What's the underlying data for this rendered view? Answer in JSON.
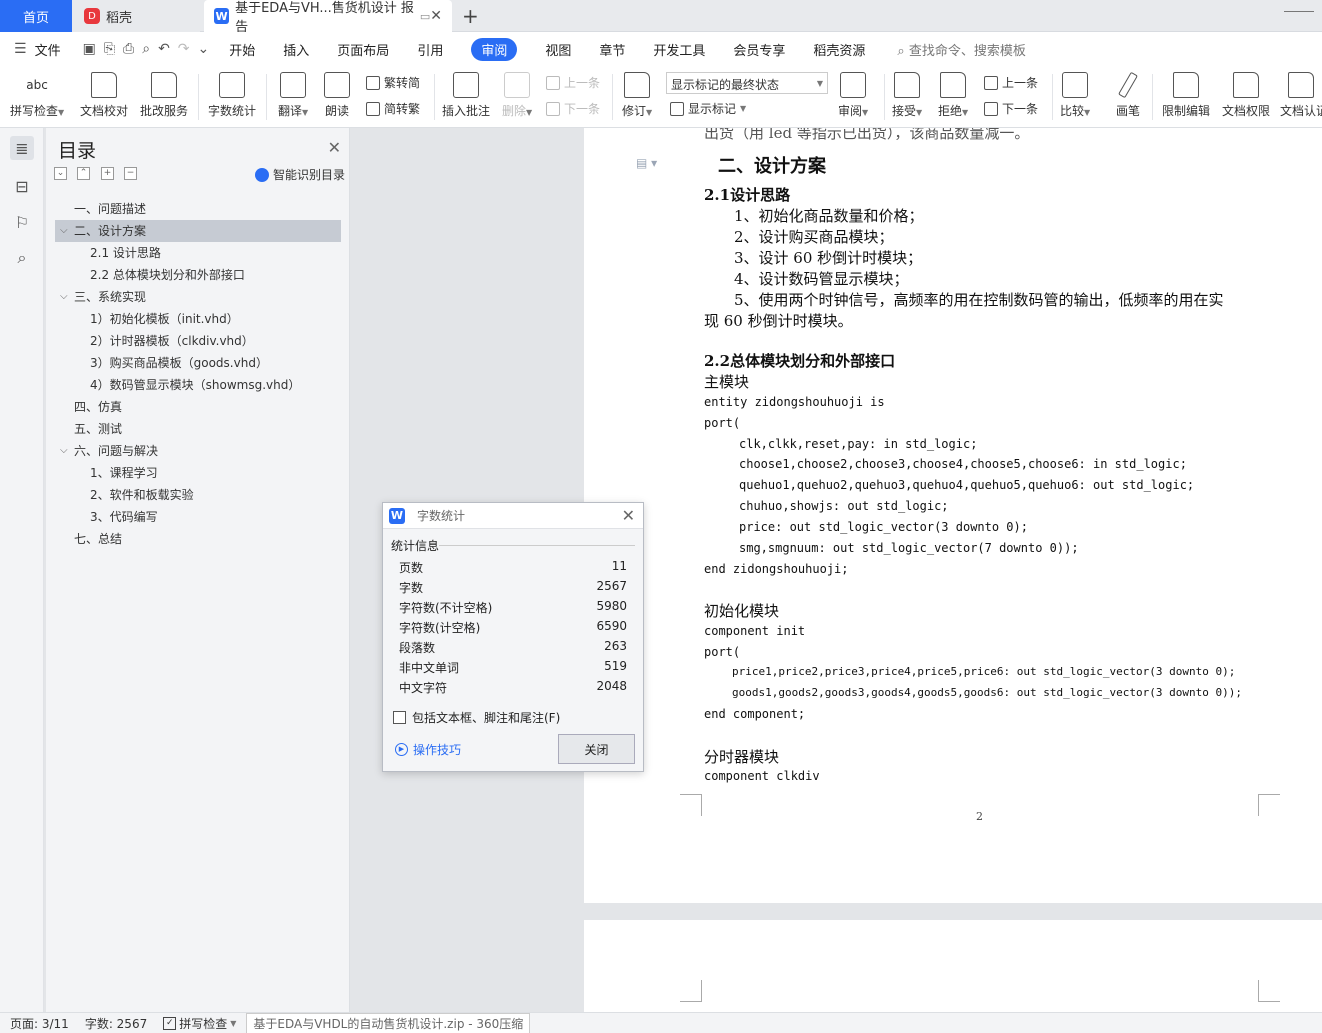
{
  "tabs": {
    "home": "首页",
    "daoke": "稻壳",
    "doc": "基于EDA与VH...售货机设计 报告"
  },
  "menu": {
    "file": "文件",
    "items": [
      "开始",
      "插入",
      "页面布局",
      "引用",
      "审阅",
      "视图",
      "章节",
      "开发工具",
      "会员专享",
      "稻壳资源"
    ],
    "active_index": 4,
    "search_placeholder": "查找命令、搜索模板"
  },
  "ribbon": {
    "spell": "拼写检查",
    "proof": "文档校对",
    "batch": "批改服务",
    "wordcount": "字数统计",
    "translate": "翻译",
    "read": "朗读",
    "to_trad": "繁转简",
    "to_simp": "简转繁",
    "insert_comment": "插入批注",
    "delete": "删除",
    "prev": "上一条",
    "next": "下一条",
    "revise": "修订",
    "markup_state": "显示标记的最终状态",
    "show_markup": "显示标记",
    "review": "审阅",
    "accept": "接受",
    "reject": "拒绝",
    "prev2": "上一条",
    "next2": "下一条",
    "compare": "比较",
    "pen": "画笔",
    "restrict": "限制编辑",
    "perm": "文档权限",
    "cert": "文档认证"
  },
  "outline": {
    "title": "目录",
    "smart": "智能识别目录",
    "items": [
      "一、问题描述",
      "二、设计方案",
      "2.1 设计思路",
      "2.2 总体模块划分和外部接口",
      "三、系统实现",
      "1）初始化模板（init.vhd）",
      "2）计时器模板（clkdiv.vhd）",
      "3）购买商品模板（goods.vhd）",
      "4）数码管显示模块（showmsg.vhd）",
      "四、仿真",
      "五、测试",
      "六、问题与解决",
      "1、课程学习",
      "2、软件和板载实验",
      "3、代码编写",
      "七、总结"
    ]
  },
  "document": {
    "top_partial": "出货（用 led 等指示已出货），该商品数量减一。",
    "h2": "二、设计方案",
    "h3_1": "2.1设计思路",
    "steps": [
      "1、初始化商品数量和价格；",
      "2、设计购买商品模块；",
      "3、设计 60 秒倒计时模块；",
      "4、设计数码管显示模块；",
      "5、使用两个时钟信号，高频率的用在控制数码管的输出，低频率的用在实",
      "现 60 秒倒计时模块。"
    ],
    "h3_2": "2.2总体模块划分和外部接口",
    "main_label": "主模块",
    "main_code": [
      "entity zidongshouhuoji is",
      "port(",
      "clk,clkk,reset,pay: in std_logic;",
      "choose1,choose2,choose3,choose4,choose5,choose6: in std_logic;",
      "quehuo1,quehuo2,quehuo3,quehuo4,quehuo5,quehuo6: out std_logic;",
      "chuhuo,showjs: out std_logic;",
      "price: out std_logic_vector(3 downto 0);",
      "smg,smgnuum: out std_logic_vector(7 downto 0));",
      "end zidongshouhuoji;"
    ],
    "init_label": "初始化模块",
    "init_code": [
      "component init",
      "port(",
      "price1,price2,price3,price4,price5,price6: out std_logic_vector(3 downto 0);",
      "goods1,goods2,goods3,goods4,goods5,goods6: out std_logic_vector(3 downto 0));",
      "end component;"
    ],
    "clk_label": "分时器模块",
    "clk_code": [
      "component clkdiv"
    ],
    "page_number": "2"
  },
  "dialog": {
    "title": "字数统计",
    "section": "统计信息",
    "rows": [
      {
        "label": "页数",
        "value": "11"
      },
      {
        "label": "字数",
        "value": "2567"
      },
      {
        "label": "字符数(不计空格)",
        "value": "5980"
      },
      {
        "label": "字符数(计空格)",
        "value": "6590"
      },
      {
        "label": "段落数",
        "value": "263"
      },
      {
        "label": "非中文单词",
        "value": "519"
      },
      {
        "label": "中文字符",
        "value": "2048"
      }
    ],
    "checkbox_label": "包括文本框、脚注和尾注(F)",
    "tips": "操作技巧",
    "close": "关闭"
  },
  "status": {
    "page": "页面: 3/11",
    "words": "字数: 2567",
    "spell": "拼写检查",
    "overlay": "基于EDA与VHDL的自动售货机设计.zip - 360压缩"
  }
}
